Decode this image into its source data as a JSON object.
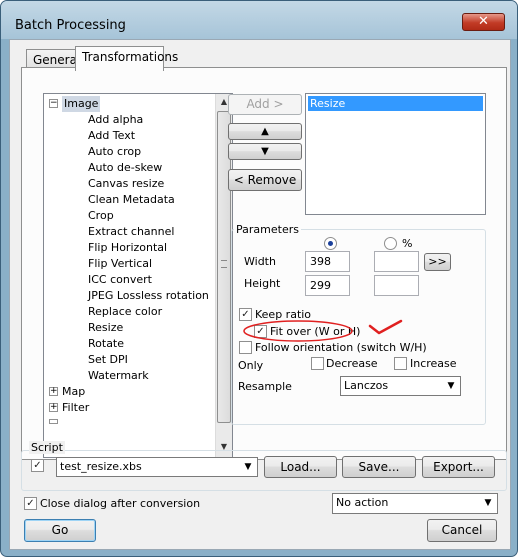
{
  "window": {
    "title": "Batch Processing"
  },
  "tabs": [
    {
      "label": "General"
    },
    {
      "label": "Transformations"
    }
  ],
  "tree": {
    "root_label": "Image",
    "items": [
      "Add alpha",
      "Add Text",
      "Auto crop",
      "Auto de-skew",
      "Canvas resize",
      "Clean Metadata",
      "Crop",
      "Extract channel",
      "Flip Horizontal",
      "Flip Vertical",
      "ICC convert",
      "JPEG Lossless rotation",
      "Replace color",
      "Resize",
      "Rotate",
      "Set DPI",
      "Watermark"
    ],
    "collapsed": [
      "Map",
      "Filter"
    ]
  },
  "actions": {
    "add_label": "Add >",
    "up_symbol": "▲",
    "down_symbol": "▼",
    "remove_label": "< Remove"
  },
  "selected_list": [
    "Resize"
  ],
  "parameters": {
    "group_label": "Parameters",
    "percent_label": "%",
    "width_label": "Width",
    "width_value": "398",
    "height_label": "Height",
    "height_value": "299",
    "copy_button": ">>",
    "keep_ratio_label": "Keep ratio",
    "fit_over_label": "Fit over (W or H)",
    "follow_orientation_label": "Follow orientation (switch W/H)",
    "only_label": "Only",
    "decrease_label": "Decrease",
    "increase_label": "Increase",
    "resample_label": "Resample",
    "resample_value": "Lanczos"
  },
  "script": {
    "group_label": "Script",
    "file_value": "test_resize.xbs",
    "load_label": "Load...",
    "save_label": "Save...",
    "export_label": "Export..."
  },
  "bottom": {
    "close_after_label": "Close dialog after conversion",
    "action_value": "No action",
    "go_label": "Go",
    "cancel_label": "Cancel"
  },
  "annotation": {
    "color": "#e02020"
  }
}
